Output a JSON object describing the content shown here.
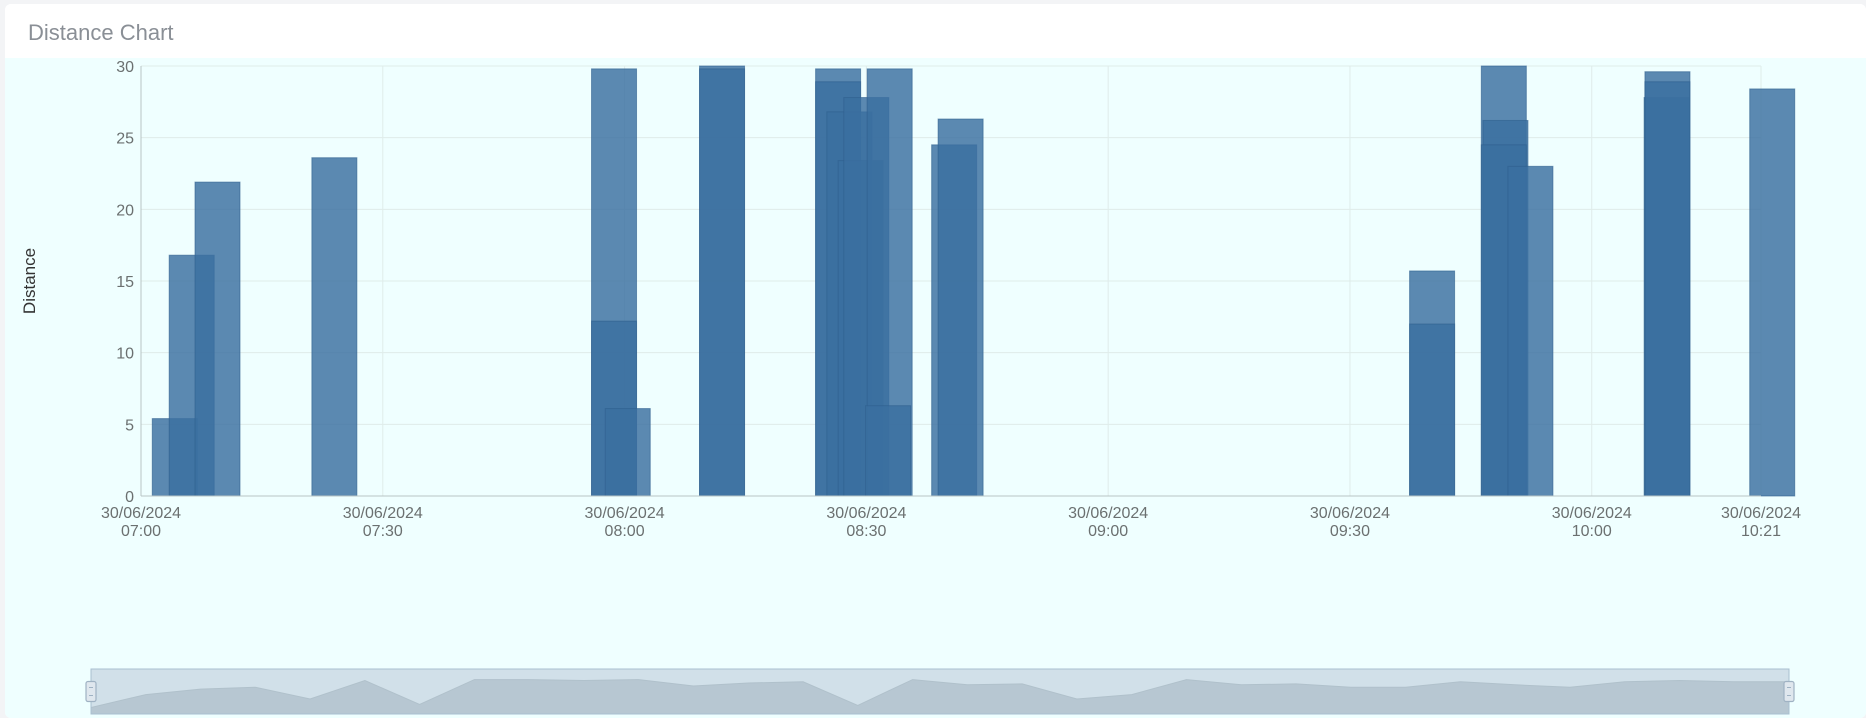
{
  "card": {
    "title": "Distance Chart"
  },
  "colors": {
    "bar": "#3b6fa0",
    "bar_dark": "#356a9c",
    "grid": "#dfecea",
    "axis": "#b8c4c4",
    "background": "#efffff"
  },
  "chart_data": {
    "type": "bar",
    "ylabel": "Distance",
    "xlabel": "",
    "ylim": [
      0,
      30
    ],
    "yticks": [
      0,
      5,
      10,
      15,
      20,
      25,
      30
    ],
    "xlim": [
      "2024-06-30 07:00",
      "2024-06-30 10:21"
    ],
    "xticks": [
      {
        "date": "30/06/2024",
        "time": "07:00",
        "minute": 0
      },
      {
        "date": "30/06/2024",
        "time": "07:30",
        "minute": 30
      },
      {
        "date": "30/06/2024",
        "time": "08:00",
        "minute": 60
      },
      {
        "date": "30/06/2024",
        "time": "08:30",
        "minute": 90
      },
      {
        "date": "30/06/2024",
        "time": "09:00",
        "minute": 120
      },
      {
        "date": "30/06/2024",
        "time": "09:30",
        "minute": 150
      },
      {
        "date": "30/06/2024",
        "time": "10:00",
        "minute": 180
      },
      {
        "date": "30/06/2024",
        "time": "10:21",
        "minute": 201
      }
    ],
    "grid": true,
    "bars": [
      {
        "minute": 1.4,
        "value": 5.4
      },
      {
        "minute": 3.5,
        "value": 16.8
      },
      {
        "minute": 6.7,
        "value": 21.9
      },
      {
        "minute": 21.2,
        "value": 23.6
      },
      {
        "minute": 55.9,
        "value": 29.8
      },
      {
        "minute": 55.9,
        "value": 12.2
      },
      {
        "minute": 57.6,
        "value": 6.1
      },
      {
        "minute": 69.3,
        "value": 30.0
      },
      {
        "minute": 69.3,
        "value": 29.8
      },
      {
        "minute": 83.7,
        "value": 29.8
      },
      {
        "minute": 83.7,
        "value": 28.9
      },
      {
        "minute": 85.1,
        "value": 26.8
      },
      {
        "minute": 86.5,
        "value": 23.4
      },
      {
        "minute": 87.2,
        "value": 27.8
      },
      {
        "minute": 90.1,
        "value": 29.8
      },
      {
        "minute": 89.9,
        "value": 6.3
      },
      {
        "minute": 98.1,
        "value": 24.5
      },
      {
        "minute": 98.9,
        "value": 26.3
      },
      {
        "minute": 157.4,
        "value": 15.7
      },
      {
        "minute": 157.4,
        "value": 12.0
      },
      {
        "minute": 166.3,
        "value": 30.0
      },
      {
        "minute": 166.5,
        "value": 26.2
      },
      {
        "minute": 166.3,
        "value": 24.5
      },
      {
        "minute": 169.6,
        "value": 23.0
      },
      {
        "minute": 186.5,
        "value": 27.8
      },
      {
        "minute": 186.6,
        "value": 29.6
      },
      {
        "minute": 186.6,
        "value": 28.9
      },
      {
        "minute": 199.6,
        "value": 28.4
      }
    ],
    "zoom_slider": {
      "range_start": 0,
      "range_end": 1,
      "overview_values": [
        0.15,
        0.45,
        0.58,
        0.62,
        0.35,
        0.78,
        0.22,
        0.8,
        0.8,
        0.78,
        0.8,
        0.65,
        0.72,
        0.75,
        0.2,
        0.8,
        0.68,
        0.7,
        0.35,
        0.45,
        0.8,
        0.68,
        0.7,
        0.62,
        0.62,
        0.75,
        0.68,
        0.62,
        0.75,
        0.78,
        0.75,
        0.75
      ]
    }
  }
}
